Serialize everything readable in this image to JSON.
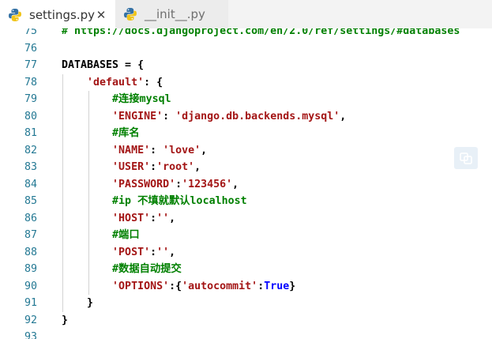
{
  "tabs": [
    {
      "label": "settings.py",
      "active": true,
      "icon": "python-icon",
      "close": "✕"
    },
    {
      "label": "__init__.py",
      "active": false,
      "icon": "python-icon"
    }
  ],
  "lines": [
    {
      "n": "75",
      "segs": [
        {
          "c": "c",
          "t": "# https://docs.djangoproject.com/en/2.0/ref/settings/#databases"
        }
      ]
    },
    {
      "n": "76",
      "segs": []
    },
    {
      "n": "77",
      "segs": [
        {
          "c": "p",
          "t": "DATABASES = {"
        }
      ]
    },
    {
      "n": "78",
      "segs": [
        {
          "c": "p",
          "t": "    "
        },
        {
          "c": "s",
          "t": "'default'"
        },
        {
          "c": "p",
          "t": ": {"
        }
      ]
    },
    {
      "n": "79",
      "segs": [
        {
          "c": "p",
          "t": "        "
        },
        {
          "c": "c",
          "t": "#连接mysql"
        }
      ]
    },
    {
      "n": "80",
      "segs": [
        {
          "c": "p",
          "t": "        "
        },
        {
          "c": "s",
          "t": "'ENGINE'"
        },
        {
          "c": "p",
          "t": ": "
        },
        {
          "c": "s",
          "t": "'django.db.backends.mysql'"
        },
        {
          "c": "p",
          "t": ","
        }
      ]
    },
    {
      "n": "81",
      "segs": [
        {
          "c": "p",
          "t": "        "
        },
        {
          "c": "c",
          "t": "#库名"
        }
      ]
    },
    {
      "n": "82",
      "segs": [
        {
          "c": "p",
          "t": "        "
        },
        {
          "c": "s",
          "t": "'NAME'"
        },
        {
          "c": "p",
          "t": ": "
        },
        {
          "c": "s",
          "t": "'love'"
        },
        {
          "c": "p",
          "t": ","
        }
      ]
    },
    {
      "n": "83",
      "segs": [
        {
          "c": "p",
          "t": "        "
        },
        {
          "c": "s",
          "t": "'USER'"
        },
        {
          "c": "p",
          "t": ":"
        },
        {
          "c": "s",
          "t": "'root'"
        },
        {
          "c": "p",
          "t": ","
        }
      ]
    },
    {
      "n": "84",
      "segs": [
        {
          "c": "p",
          "t": "        "
        },
        {
          "c": "s",
          "t": "'PASSWORD'"
        },
        {
          "c": "p",
          "t": ":"
        },
        {
          "c": "s",
          "t": "'123456'"
        },
        {
          "c": "p",
          "t": ","
        }
      ]
    },
    {
      "n": "85",
      "segs": [
        {
          "c": "p",
          "t": "        "
        },
        {
          "c": "c",
          "t": "#ip 不填就默认localhost"
        }
      ]
    },
    {
      "n": "86",
      "segs": [
        {
          "c": "p",
          "t": "        "
        },
        {
          "c": "s",
          "t": "'HOST'"
        },
        {
          "c": "p",
          "t": ":"
        },
        {
          "c": "s",
          "t": "''"
        },
        {
          "c": "p",
          "t": ","
        }
      ]
    },
    {
      "n": "87",
      "segs": [
        {
          "c": "p",
          "t": "        "
        },
        {
          "c": "c",
          "t": "#端口"
        }
      ]
    },
    {
      "n": "88",
      "segs": [
        {
          "c": "p",
          "t": "        "
        },
        {
          "c": "s",
          "t": "'POST'"
        },
        {
          "c": "p",
          "t": ":"
        },
        {
          "c": "s",
          "t": "''"
        },
        {
          "c": "p",
          "t": ","
        }
      ]
    },
    {
      "n": "89",
      "segs": [
        {
          "c": "p",
          "t": "        "
        },
        {
          "c": "c",
          "t": "#数据自动提交"
        }
      ]
    },
    {
      "n": "90",
      "segs": [
        {
          "c": "p",
          "t": "        "
        },
        {
          "c": "s",
          "t": "'OPTIONS'"
        },
        {
          "c": "p",
          "t": ":{"
        },
        {
          "c": "s",
          "t": "'autocommit'"
        },
        {
          "c": "p",
          "t": ":"
        },
        {
          "c": "k",
          "t": "True"
        },
        {
          "c": "p",
          "t": "}"
        }
      ]
    },
    {
      "n": "91",
      "segs": [
        {
          "c": "p",
          "t": "    }"
        }
      ]
    },
    {
      "n": "92",
      "segs": [
        {
          "c": "p",
          "t": "}"
        }
      ]
    },
    {
      "n": "93",
      "segs": []
    }
  ],
  "hint_icon": "translate-icon",
  "colors": {
    "comment": "#008000",
    "string": "#a31515",
    "keyword": "#0000ff",
    "line_number": "#237893"
  }
}
